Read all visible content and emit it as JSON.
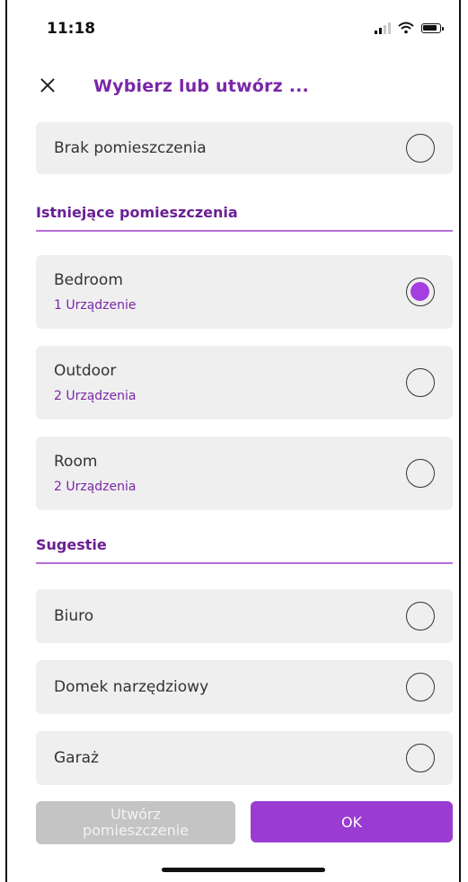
{
  "status_bar": {
    "time": "11:18"
  },
  "header": {
    "title": "Wybierz lub utwórz ..."
  },
  "no_room": {
    "label": "Brak pomieszczenia",
    "selected": false
  },
  "existing": {
    "title": "Istniejące pomieszczenia",
    "items": [
      {
        "label": "Bedroom",
        "count": "1 Urządzenie",
        "selected": true
      },
      {
        "label": "Outdoor",
        "count": "2 Urządzenia",
        "selected": false
      },
      {
        "label": "Room",
        "count": "2 Urządzenia",
        "selected": false
      }
    ]
  },
  "suggestions": {
    "title": "Sugestie",
    "items": [
      {
        "label": "Biuro",
        "selected": false
      },
      {
        "label": "Domek narzędziowy",
        "selected": false
      },
      {
        "label": "Garaż",
        "selected": false
      }
    ]
  },
  "footer": {
    "create_line1": "Utwórz",
    "create_line2": "pomieszczenie",
    "ok_label": "OK"
  },
  "colors": {
    "accent": "#9a3bd1",
    "title": "#7a26a8",
    "card": "#efefef",
    "disabled": "#c4c4c4"
  },
  "icons": {
    "close": "close-icon",
    "signal": "signal-icon",
    "wifi": "wifi-icon",
    "battery": "battery-icon"
  }
}
